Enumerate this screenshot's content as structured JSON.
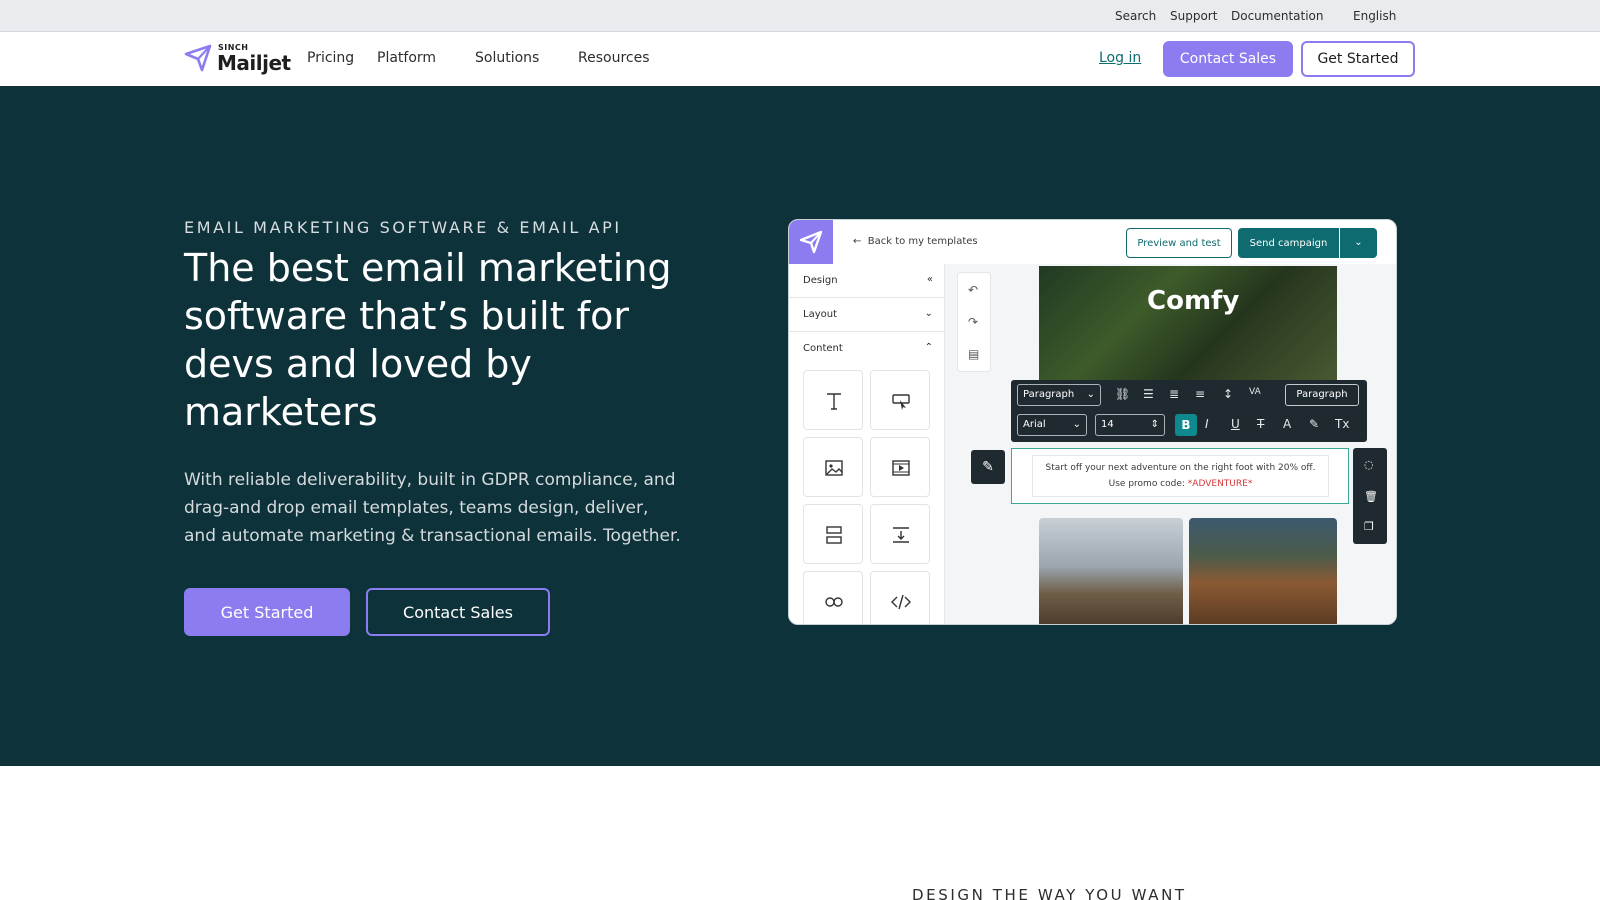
{
  "utility": {
    "search": "Search",
    "support": "Support",
    "documentation": "Documentation",
    "language": "English"
  },
  "nav": {
    "logo_sinch": "SINCH",
    "logo_word": "Mailjet",
    "pricing": "Pricing",
    "platform": "Platform",
    "solutions": "Solutions",
    "resources": "Resources",
    "login": "Log in",
    "contact_sales": "Contact Sales",
    "get_started": "Get Started"
  },
  "hero": {
    "eyebrow": "EMAIL MARKETING SOFTWARE & EMAIL API",
    "title": "The best email marketing software that’s built for devs and loved by marketers",
    "description": "With reliable deliverability, built in GDPR compliance, and drag-and drop email templates, teams design, deliver, and automate marketing & transactional emails. Together.",
    "get_started": "Get Started",
    "contact_sales": "Contact Sales"
  },
  "editor": {
    "back_link": "Back to my templates",
    "preview_button": "Preview and test",
    "send_button": "Send campaign",
    "sidebar": {
      "design": "Design",
      "layout": "Layout",
      "content": "Content"
    },
    "email_brand": "Comfy",
    "toolbar": {
      "paragraph_select": "Paragraph",
      "font_select": "Arial",
      "size_value": "14",
      "bold": "B",
      "paragraph_button": "Paragraph"
    },
    "text_line1": "Start off your next adventure on the right foot with 20% off.",
    "text_line2_prefix": "Use promo code: ",
    "promo_code": "*ADVENTURE*"
  },
  "next_section": {
    "eyebrow": "DESIGN THE WAY YOU WANT"
  },
  "colors": {
    "hero_bg": "#0e323a",
    "accent_purple": "#8b7cf0",
    "teal": "#0e6b6f"
  }
}
